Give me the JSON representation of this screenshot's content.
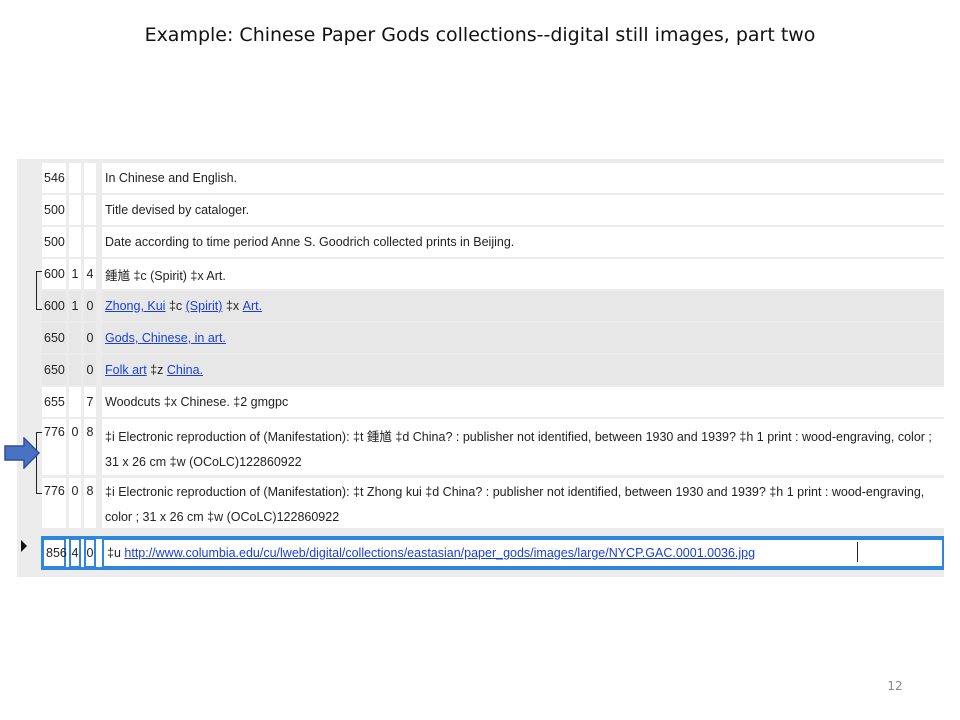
{
  "slide": {
    "title": "Example: Chinese Paper Gods collections--digital still images, part two",
    "page_number": "12"
  },
  "rows": [
    {
      "tag": "546",
      "ind1": "",
      "ind2": "",
      "text": "In Chinese and English."
    },
    {
      "tag": "500",
      "ind1": "",
      "ind2": "",
      "text": "Title devised by cataloger."
    },
    {
      "tag": "500",
      "ind1": "",
      "ind2": "",
      "text": "Date according to time period Anne S. Goodrich collected prints in Beijing."
    },
    {
      "tag": "600",
      "ind1": "1",
      "ind2": "4",
      "text": "鍾馗 ‡c (Spirit) ‡x Art."
    },
    {
      "tag": "600",
      "ind1": "1",
      "ind2": "0",
      "a": "Zhong, Kui",
      "c_code": "‡c",
      "c": "(Spirit)",
      "x_code": "‡x",
      "x": "Art."
    },
    {
      "tag": "650",
      "ind1": "",
      "ind2": "0",
      "a": "Gods, Chinese, in art."
    },
    {
      "tag": "650",
      "ind1": "",
      "ind2": "0",
      "a": "Folk art",
      "z_code": "‡z",
      "z": "China."
    },
    {
      "tag": "655",
      "ind1": "",
      "ind2": "7",
      "text": "Woodcuts ‡x Chinese. ‡2 gmgpc"
    },
    {
      "tag": "776",
      "ind1": "0",
      "ind2": "8",
      "text": "‡i Electronic reproduction of (Manifestation): ‡t 鍾馗 ‡d China? : publisher not identified, between 1930 and 1939? ‡h 1 print : wood-engraving, color ; 31 x 26 cm ‡w (OCoLC)122860922"
    },
    {
      "tag": "776",
      "ind1": "0",
      "ind2": "8",
      "text": "‡i Electronic reproduction of (Manifestation): ‡t Zhong kui ‡d China? : publisher not identified, between 1930 and 1939? ‡h 1 print : wood-engraving, color ; 31 x 26 cm ‡w (OCoLC)122860922"
    },
    {
      "tag": "856",
      "ind1": "4",
      "ind2": "0",
      "u_code": "‡u",
      "url": "http://www.columbia.edu/cu/lweb/digital/collections/eastasian/paper_gods/images/large/NYCP.GAC.0001.0036.jpg"
    }
  ],
  "colors": {
    "accent": "#2e86de",
    "link": "#1a3fd6",
    "arrow": "#4a72c4",
    "panel": "#ececec"
  },
  "icons": {
    "arrow": "right-arrow-icon",
    "pointer": "row-pointer-icon"
  }
}
